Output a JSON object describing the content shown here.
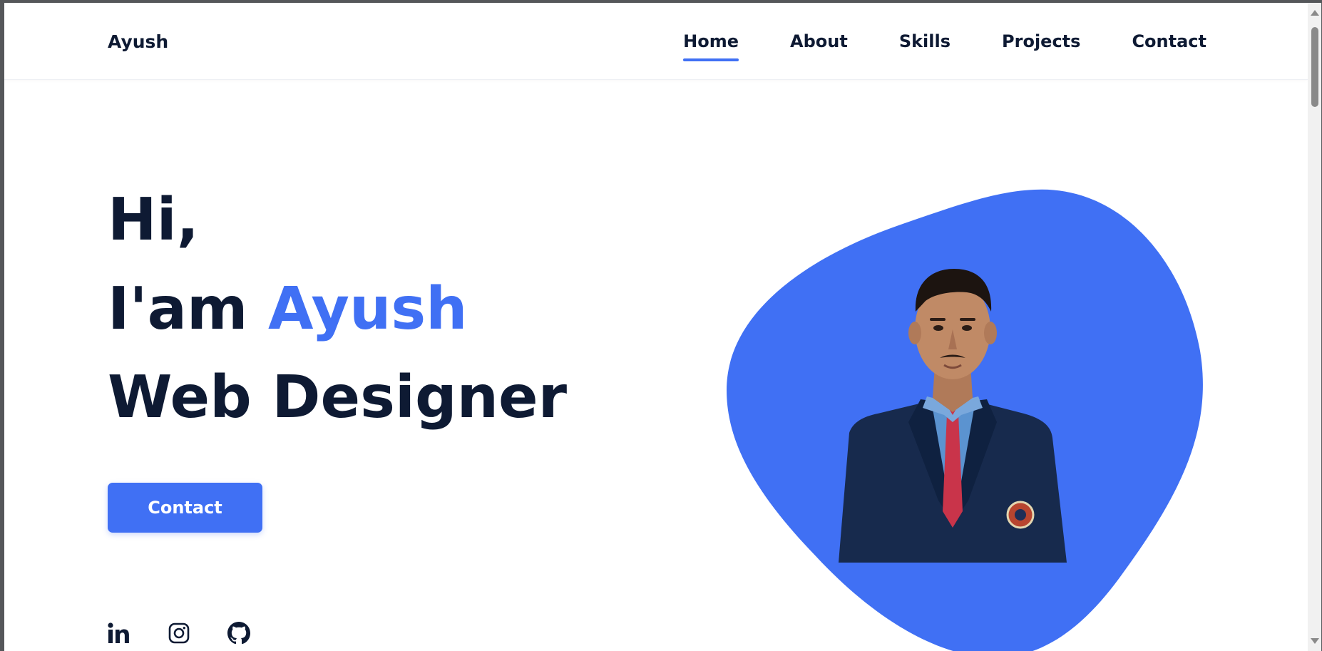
{
  "header": {
    "logo": "Ayush",
    "nav": [
      {
        "label": "Home",
        "active": true
      },
      {
        "label": "About",
        "active": false
      },
      {
        "label": "Skills",
        "active": false
      },
      {
        "label": "Projects",
        "active": false
      },
      {
        "label": "Contact",
        "active": false
      }
    ]
  },
  "hero": {
    "greeting": "Hi,",
    "intro_prefix": "I'am",
    "name": "Ayush",
    "role": "Web Designer",
    "contact_button": "Contact"
  },
  "social": [
    {
      "icon": "linkedin-icon"
    },
    {
      "icon": "instagram-icon"
    },
    {
      "icon": "github-icon"
    }
  ],
  "colors": {
    "accent": "#4070f4",
    "text_dark": "#0e1a33",
    "background": "#ffffff"
  }
}
